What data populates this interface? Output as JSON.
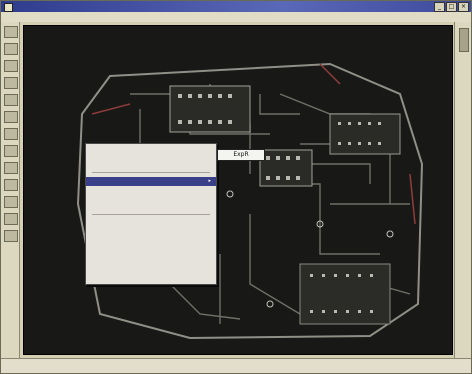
{
  "window": {
    "title": "",
    "controls": {
      "minimize": "_",
      "maximize": "□",
      "close": "×"
    }
  },
  "menubar": {
    "items": [
      "",
      "",
      "",
      "",
      "",
      "",
      "",
      ""
    ]
  },
  "toolbar": {
    "tools": [
      "",
      "",
      "",
      "",
      "",
      "",
      "",
      "",
      "",
      "",
      "",
      "",
      ""
    ]
  },
  "context_menu": {
    "items": [
      {
        "label": "",
        "shortcut": ""
      },
      {
        "label": "",
        "shortcut": ""
      },
      {
        "label": "",
        "shortcut": "",
        "selected": true,
        "submenu": true
      },
      {
        "label": "",
        "shortcut": ""
      },
      {
        "label": "",
        "shortcut": ""
      },
      {
        "label": "",
        "shortcut": ""
      },
      {
        "label": "",
        "shortcut": ""
      },
      {
        "label": "",
        "shortcut": ""
      },
      {
        "label": "",
        "shortcut": ""
      },
      {
        "label": "",
        "shortcut": ""
      },
      {
        "label": "",
        "shortcut": ""
      }
    ],
    "submenu_tip": "ExpR"
  },
  "statusbar": {
    "text": ""
  },
  "colors": {
    "board_trace": "#7a7a74",
    "board_pad": "#b9b9b2",
    "background": "#181816",
    "selection": "#3a3f8a",
    "accent_red": "#8e3c3c"
  }
}
